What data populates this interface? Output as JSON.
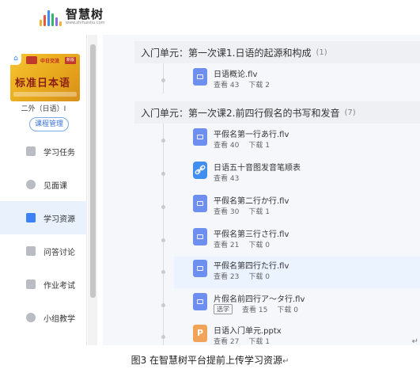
{
  "header": {
    "logo_name": "智慧树",
    "logo_url": "www.zhihuishu.com",
    "logo_bar_colors": [
      "#f3b22a",
      "#e8573c",
      "#3d8ef0",
      "#37b36b",
      "#8a6de9",
      "#f3b22a"
    ]
  },
  "sidebar": {
    "cover": {
      "subtitle": "中日交流",
      "tag": "新版",
      "title": "标准日本语"
    },
    "course_name": "二外（日语）I",
    "manage_button": "课程管理",
    "items": [
      {
        "label": "学习任务",
        "icon": "calendar-icon",
        "active": false
      },
      {
        "label": "见面课",
        "icon": "user-icon",
        "active": false
      },
      {
        "label": "学习资源",
        "icon": "folder-icon",
        "active": true
      },
      {
        "label": "问答讨论",
        "icon": "question-icon",
        "active": false
      },
      {
        "label": "作业考试",
        "icon": "exam-icon",
        "active": false
      },
      {
        "label": "小组教学",
        "icon": "group-icon",
        "active": false
      }
    ]
  },
  "content": {
    "chapters": [
      {
        "title": "入门单元：第一次课1.日语的起源和构成",
        "count": "(1)",
        "resources": [
          {
            "title": "日语概论.flv",
            "type": "video",
            "views": "查看 43",
            "downloads": "下载 2",
            "elective": "",
            "highlight": false
          }
        ]
      },
      {
        "title": "入门单元：第一次课2.前四行假名的书写和发音",
        "count": "(7)",
        "resources": [
          {
            "title": "平假名第一行あ行.flv",
            "type": "video",
            "views": "查看 40",
            "downloads": "下载 1",
            "elective": "",
            "highlight": false
          },
          {
            "title": "日语五十音图发音笔顺表",
            "type": "link",
            "views": "查看 43",
            "downloads": "",
            "elective": "",
            "highlight": false
          },
          {
            "title": "平假名第二行か行.flv",
            "type": "video",
            "views": "查看 30",
            "downloads": "下载 1",
            "elective": "",
            "highlight": false
          },
          {
            "title": "平假名第三行さ行.flv",
            "type": "video",
            "views": "查看 21",
            "downloads": "下载 0",
            "elective": "",
            "highlight": false
          },
          {
            "title": "平假名第四行た行.flv",
            "type": "video",
            "views": "查看 23",
            "downloads": "下载 0",
            "elective": "",
            "highlight": true
          },
          {
            "title": "片假名前四行ア～タ行.flv",
            "type": "video",
            "views": "查看 15",
            "downloads": "下载 0",
            "elective": "选学",
            "highlight": false
          },
          {
            "title": "日语入门单元.pptx",
            "type": "ppt",
            "views": "查看 27",
            "downloads": "下载 1",
            "elective": "",
            "highlight": false
          }
        ]
      }
    ],
    "ppt_letter": "P",
    "corner_mark": "↵"
  },
  "caption": {
    "text": "图3 在智慧树平台提前上传学习资源",
    "mark": "↵"
  }
}
